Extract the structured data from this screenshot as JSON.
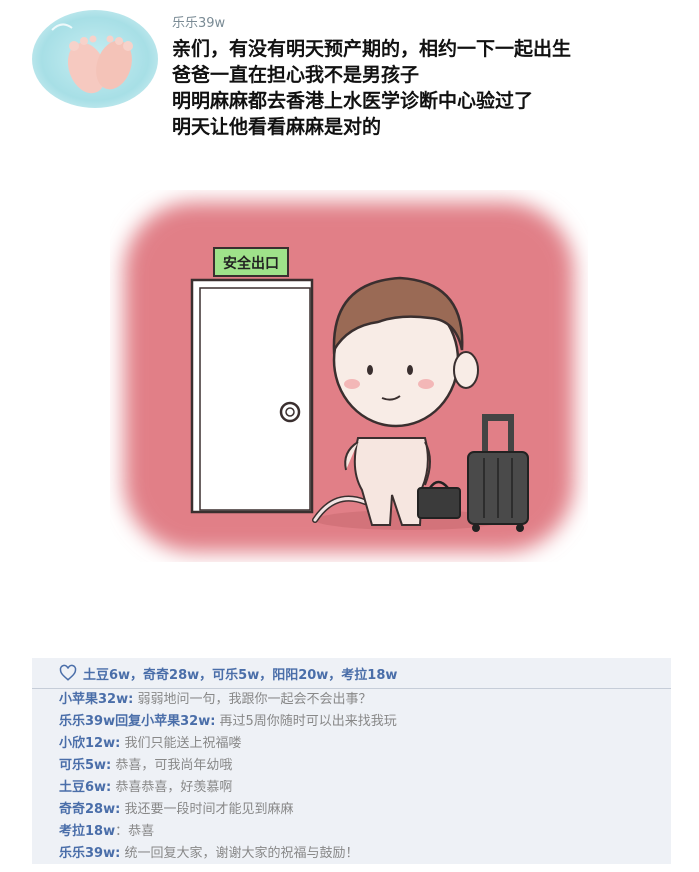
{
  "post": {
    "author": "乐乐39w",
    "avatar_icon": "baby-feet-icon",
    "lines": [
      "亲们，有没有明天预产期的，相约一下一起出生",
      "爸爸一直在担心我不是男孩子",
      "明明麻麻都去香港上水医学诊断中心验过了",
      "明天让他看看麻麻是对的"
    ]
  },
  "illustration": {
    "exit_sign": "安全出口"
  },
  "likes": {
    "icon": "heart-icon",
    "text": "土豆6w，奇奇28w，可乐5w，阳阳20w，考拉18w"
  },
  "comments": [
    {
      "user": "小苹果32w:",
      "text": " 弱弱地问一句，我跟你一起会不会出事？"
    },
    {
      "user": "乐乐39w回复小苹果32w:",
      "text": " 再过5周你随时可以出来找我玩"
    },
    {
      "user": "小欣12w:",
      "text": " 我们只能送上祝福喽"
    },
    {
      "user": "可乐5w:",
      "text": " 恭喜，可我尚年幼哦"
    },
    {
      "user": "土豆6w:",
      "text": " 恭喜恭喜，好羡慕啊"
    },
    {
      "user": "奇奇28w:",
      "text": " 我还要一段时间才能见到麻麻"
    },
    {
      "user": "考拉18w",
      "text": "：恭喜"
    },
    {
      "user": "乐乐39w:",
      "text": " 统一回复大家，谢谢大家的祝福与鼓励！"
    }
  ],
  "colors": {
    "username": "#4a6ea9",
    "comment_text": "#888888",
    "comment_bg": "#eef1f6",
    "scene_bg": "#e07f86"
  }
}
